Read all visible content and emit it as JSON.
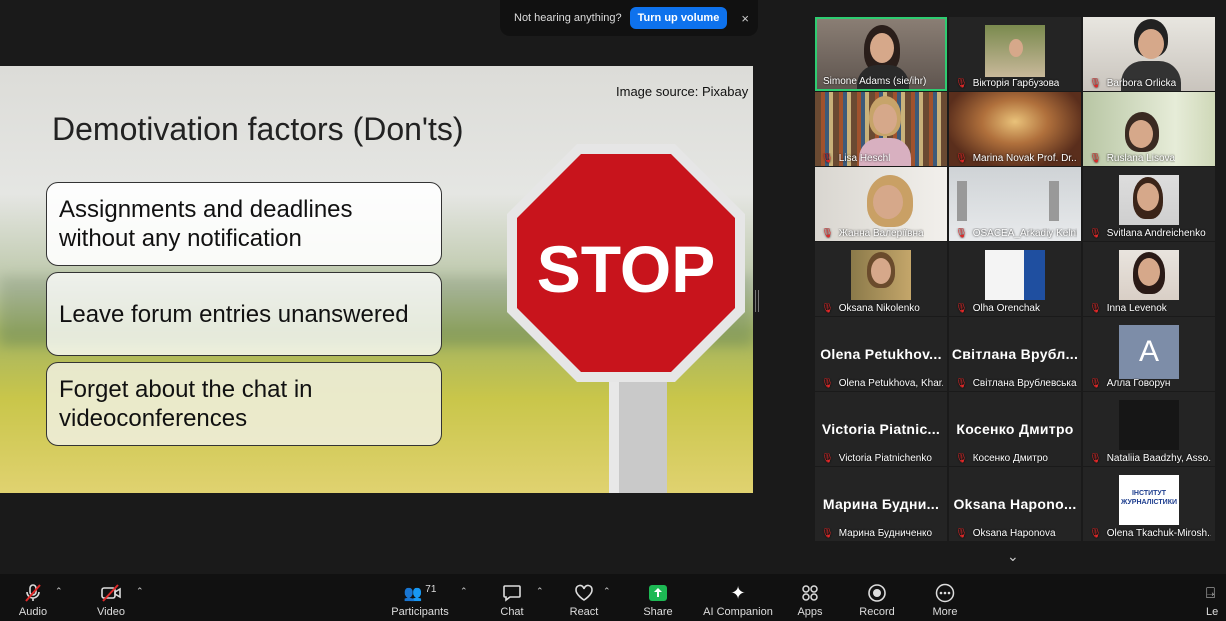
{
  "notification": {
    "text": "Not hearing anything?",
    "button_label": "Turn up volume",
    "close_label": "×"
  },
  "slide": {
    "source_text": "Image source: Pixabay",
    "title": "Demotivation factors (Don'ts)",
    "items": [
      "Assignments and deadlines without any notification",
      "Leave forum entries unanswered",
      "Forget about the chat in videoconferences"
    ],
    "sign_text": "STOP"
  },
  "participants": [
    {
      "display": "",
      "name": "Simone Adams (sie/ihr)"
    },
    {
      "display": "",
      "name": "Вікторія Гарбузова"
    },
    {
      "display": "",
      "name": "Barbora Orlicka"
    },
    {
      "display": "",
      "name": "Lisa Heschl"
    },
    {
      "display": "",
      "name": "Marina Novak Prof. Dr..."
    },
    {
      "display": "",
      "name": "Ruslana Lisova"
    },
    {
      "display": "",
      "name": "Жанна Валеріївна"
    },
    {
      "display": "",
      "name": "OSACEA_Arkadiy Kelnik"
    },
    {
      "display": "",
      "name": "Svitlana Andreichenko"
    },
    {
      "display": "",
      "name": "Oksana Nikolenko"
    },
    {
      "display": "",
      "name": "Olha Orenchak"
    },
    {
      "display": "",
      "name": "Inna Levenok"
    },
    {
      "display": "Olena Petukhov...",
      "name": "Olena Petukhova, Khar..."
    },
    {
      "display": "Світлана Врубл...",
      "name": "Світлана Врублевська"
    },
    {
      "display": "A",
      "name": "Алла Говорун"
    },
    {
      "display": "Victoria Piatnic...",
      "name": "Victoria Piatnichenko"
    },
    {
      "display": "Косенко Дмитро",
      "name": "Косенко Дмитро"
    },
    {
      "display": "",
      "name": "Nataliia Baadzhy, Asso..."
    },
    {
      "display": "Марина Будни...",
      "name": "Марина Будниченко"
    },
    {
      "display": "Oksana Hapono...",
      "name": "Oksana Haponova"
    },
    {
      "display": "ІНСТИТУТ ЖУРНАЛІСТИКИ",
      "name": "Olena Tkachuk-Mirosh..."
    }
  ],
  "toolbar": {
    "audio": "Audio",
    "video": "Video",
    "participants": "Participants",
    "participants_count": "71",
    "chat": "Chat",
    "react": "React",
    "share": "Share",
    "ai": "AI Companion",
    "apps": "Apps",
    "record": "Record",
    "more": "More",
    "leave": "Le"
  },
  "colors": {
    "accent": "#0e72ed",
    "share_green": "#1db954",
    "active_speaker": "#2ecc71",
    "mute_red": "#e02828"
  }
}
